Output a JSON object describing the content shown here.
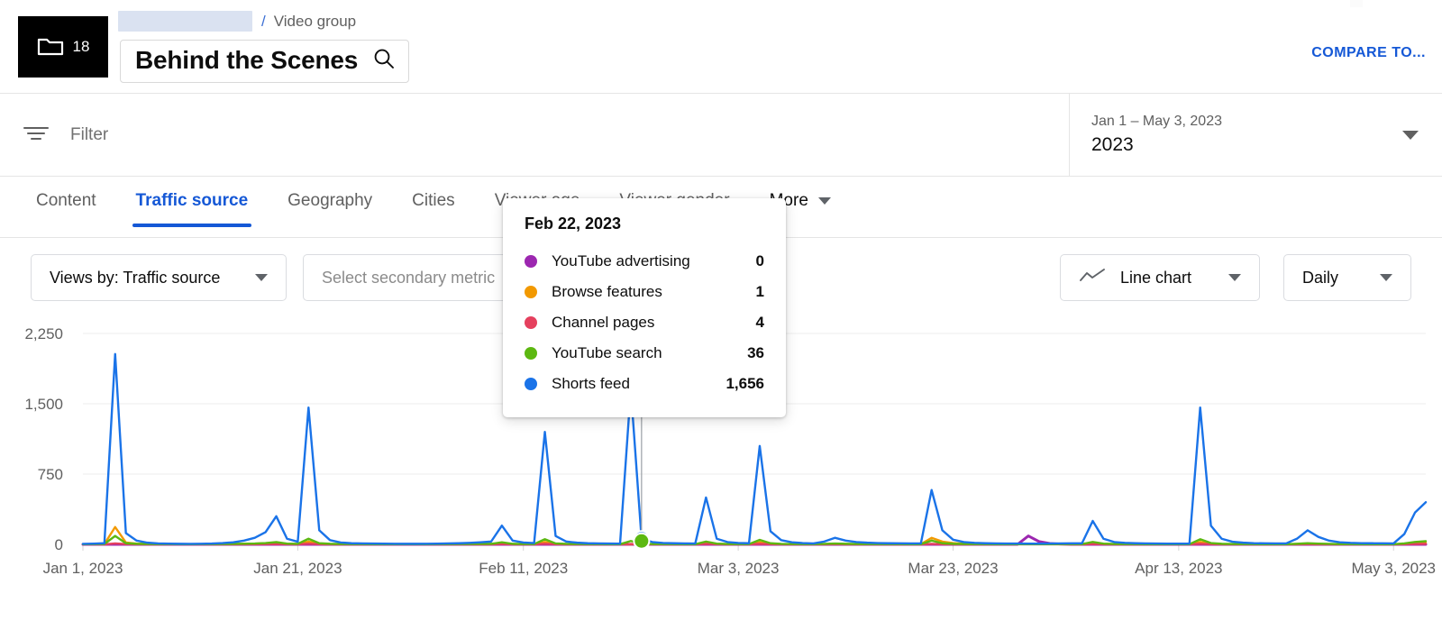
{
  "header": {
    "thumbnail": {
      "icon": "folder-icon",
      "count": "18"
    },
    "breadcrumb": {
      "redacted": "",
      "separator": "/",
      "type": "Video group"
    },
    "title": "Behind the Scenes",
    "search_icon": "search-icon",
    "compare_label": "COMPARE TO..."
  },
  "filterbar": {
    "filter_icon": "filter-icon",
    "filter_placeholder": "Filter",
    "date_range": "Jan 1 – May 3, 2023",
    "date_preset": "2023",
    "caret_icon": "chevron-down-icon"
  },
  "tabs": [
    {
      "label": "Content",
      "active": false
    },
    {
      "label": "Traffic source",
      "active": true
    },
    {
      "label": "Geography",
      "active": false
    },
    {
      "label": "Cities",
      "active": false
    },
    {
      "label": "Viewer age",
      "active": false
    },
    {
      "label": "Viewer gender",
      "active": false
    },
    {
      "label": "More",
      "active": false
    }
  ],
  "controls": {
    "views_by": "Views by: Traffic source",
    "secondary_metric_placeholder": "Select secondary metric",
    "chart_type": "Line chart",
    "chart_type_icon": "line-chart-icon",
    "granularity": "Daily"
  },
  "tooltip": {
    "date": "Feb 22, 2023",
    "rows": [
      {
        "label": "YouTube advertising",
        "value": "0",
        "color": "#9c27b0"
      },
      {
        "label": "Browse features",
        "value": "1",
        "color": "#f29900"
      },
      {
        "label": "Channel pages",
        "value": "4",
        "color": "#e5405e"
      },
      {
        "label": "YouTube search",
        "value": "36",
        "color": "#5cb811"
      },
      {
        "label": "Shorts feed",
        "value": "1,656",
        "color": "#1a73e8"
      }
    ]
  },
  "chart_data": {
    "type": "line",
    "title": "",
    "xlabel": "",
    "ylabel": "",
    "ylim": [
      0,
      2250
    ],
    "yticks": [
      0,
      750,
      1500,
      2250
    ],
    "ytick_labels": [
      "0",
      "750",
      "1,500",
      "2,250"
    ],
    "grid": true,
    "legend_position": "none",
    "xtick_labels": [
      "Jan 1, 2023",
      "Jan 21, 2023",
      "Feb 11, 2023",
      "Mar 3, 2023",
      "Mar 23, 2023",
      "Apr 13, 2023",
      "May 3, 2023"
    ],
    "xtick_indices": [
      0,
      20,
      41,
      61,
      81,
      102,
      122
    ],
    "highlight": {
      "x_index": 52,
      "date": "Feb 22, 2023",
      "series": "Shorts feed",
      "value": 1656
    },
    "series": [
      {
        "name": "Shorts feed",
        "color": "#1a73e8",
        "values": [
          5,
          8,
          12,
          2030,
          120,
          40,
          18,
          10,
          8,
          6,
          5,
          7,
          9,
          14,
          22,
          40,
          70,
          130,
          300,
          60,
          28,
          1460,
          150,
          45,
          20,
          12,
          10,
          9,
          8,
          7,
          6,
          6,
          7,
          8,
          10,
          12,
          16,
          22,
          30,
          200,
          40,
          20,
          14,
          1200,
          90,
          30,
          18,
          12,
          10,
          9,
          8,
          1656,
          60,
          25,
          15,
          12,
          10,
          9,
          500,
          60,
          25,
          15,
          12,
          1050,
          140,
          45,
          22,
          14,
          10,
          30,
          70,
          40,
          25,
          18,
          14,
          12,
          11,
          10,
          10,
          580,
          150,
          50,
          25,
          16,
          12,
          10,
          9,
          9,
          8,
          8,
          9,
          10,
          11,
          12,
          250,
          60,
          25,
          16,
          12,
          10,
          9,
          8,
          8,
          8,
          1460,
          200,
          60,
          28,
          18,
          13,
          11,
          10,
          10,
          60,
          150,
          80,
          40,
          22,
          16,
          13,
          12,
          11,
          10,
          110,
          340,
          450
        ]
      },
      {
        "name": "YouTube search",
        "color": "#5cb811",
        "values": [
          2,
          3,
          4,
          90,
          12,
          6,
          4,
          3,
          3,
          2,
          2,
          3,
          3,
          4,
          5,
          7,
          9,
          14,
          24,
          8,
          5,
          60,
          12,
          6,
          4,
          3,
          3,
          2,
          2,
          2,
          2,
          2,
          2,
          3,
          3,
          4,
          4,
          5,
          6,
          22,
          6,
          4,
          3,
          55,
          10,
          5,
          4,
          3,
          3,
          2,
          2,
          36,
          8,
          4,
          3,
          3,
          2,
          2,
          30,
          8,
          4,
          3,
          3,
          48,
          12,
          5,
          4,
          3,
          3,
          5,
          9,
          6,
          4,
          3,
          3,
          3,
          3,
          2,
          2,
          40,
          12,
          6,
          4,
          3,
          3,
          2,
          2,
          2,
          2,
          2,
          2,
          3,
          3,
          3,
          26,
          8,
          4,
          3,
          3,
          2,
          2,
          2,
          2,
          2,
          55,
          14,
          6,
          4,
          3,
          3,
          2,
          2,
          2,
          6,
          12,
          8,
          5,
          3,
          3,
          2,
          2,
          2,
          2,
          10,
          26,
          34
        ]
      },
      {
        "name": "Channel pages",
        "color": "#e5405e",
        "values": [
          1,
          1,
          1,
          10,
          3,
          2,
          1,
          1,
          1,
          1,
          1,
          1,
          1,
          1,
          1,
          2,
          2,
          3,
          4,
          2,
          1,
          8,
          2,
          1,
          1,
          1,
          1,
          1,
          1,
          1,
          1,
          1,
          1,
          1,
          1,
          1,
          1,
          1,
          1,
          4,
          1,
          1,
          1,
          7,
          2,
          1,
          1,
          1,
          1,
          1,
          1,
          4,
          2,
          1,
          1,
          1,
          1,
          1,
          5,
          2,
          1,
          1,
          1,
          6,
          2,
          1,
          1,
          1,
          1,
          1,
          2,
          1,
          1,
          1,
          1,
          1,
          1,
          1,
          1,
          5,
          2,
          1,
          1,
          1,
          1,
          1,
          1,
          1,
          1,
          1,
          1,
          1,
          1,
          1,
          4,
          2,
          1,
          1,
          1,
          1,
          1,
          1,
          1,
          1,
          7,
          2,
          1,
          1,
          1,
          1,
          1,
          1,
          1,
          1,
          2,
          1,
          1,
          1,
          1,
          1,
          1,
          1,
          1,
          2,
          4,
          5
        ]
      },
      {
        "name": "Browse features",
        "color": "#f29900",
        "values": [
          2,
          3,
          4,
          185,
          20,
          8,
          5,
          4,
          3,
          3,
          2,
          3,
          3,
          4,
          5,
          6,
          8,
          12,
          18,
          6,
          4,
          30,
          8,
          4,
          3,
          2,
          2,
          2,
          2,
          2,
          2,
          2,
          2,
          3,
          3,
          3,
          4,
          4,
          5,
          14,
          4,
          3,
          2,
          26,
          7,
          4,
          3,
          2,
          2,
          2,
          2,
          1,
          4,
          3,
          2,
          2,
          2,
          2,
          18,
          5,
          3,
          2,
          2,
          22,
          6,
          3,
          2,
          2,
          2,
          3,
          5,
          4,
          3,
          2,
          2,
          2,
          2,
          2,
          2,
          70,
          30,
          14,
          6,
          4,
          3,
          2,
          2,
          2,
          2,
          2,
          2,
          2,
          3,
          3,
          16,
          5,
          3,
          2,
          2,
          2,
          2,
          2,
          2,
          2,
          26,
          8,
          4,
          3,
          2,
          2,
          2,
          2,
          2,
          4,
          8,
          5,
          3,
          2,
          2,
          2,
          2,
          2,
          2,
          6,
          14,
          18
        ]
      },
      {
        "name": "YouTube advertising",
        "color": "#9c27b0",
        "values": [
          0,
          0,
          0,
          0,
          0,
          0,
          0,
          0,
          0,
          0,
          0,
          0,
          0,
          0,
          0,
          0,
          0,
          0,
          0,
          0,
          0,
          0,
          0,
          0,
          0,
          0,
          0,
          0,
          0,
          0,
          0,
          0,
          0,
          0,
          0,
          0,
          0,
          0,
          0,
          0,
          0,
          0,
          0,
          0,
          0,
          0,
          0,
          0,
          0,
          0,
          0,
          0,
          0,
          0,
          0,
          0,
          0,
          0,
          0,
          0,
          0,
          0,
          0,
          0,
          0,
          0,
          0,
          0,
          0,
          0,
          0,
          0,
          0,
          0,
          0,
          0,
          0,
          0,
          0,
          0,
          0,
          0,
          0,
          0,
          0,
          0,
          0,
          0,
          90,
          30,
          10,
          4,
          0,
          0,
          0,
          0,
          0,
          0,
          0,
          0,
          0,
          0,
          0,
          0,
          0,
          0,
          0,
          0,
          0,
          0,
          0,
          0,
          0,
          0,
          0,
          0,
          0,
          0,
          0,
          0,
          0,
          0,
          0,
          0,
          0,
          0
        ]
      }
    ]
  }
}
